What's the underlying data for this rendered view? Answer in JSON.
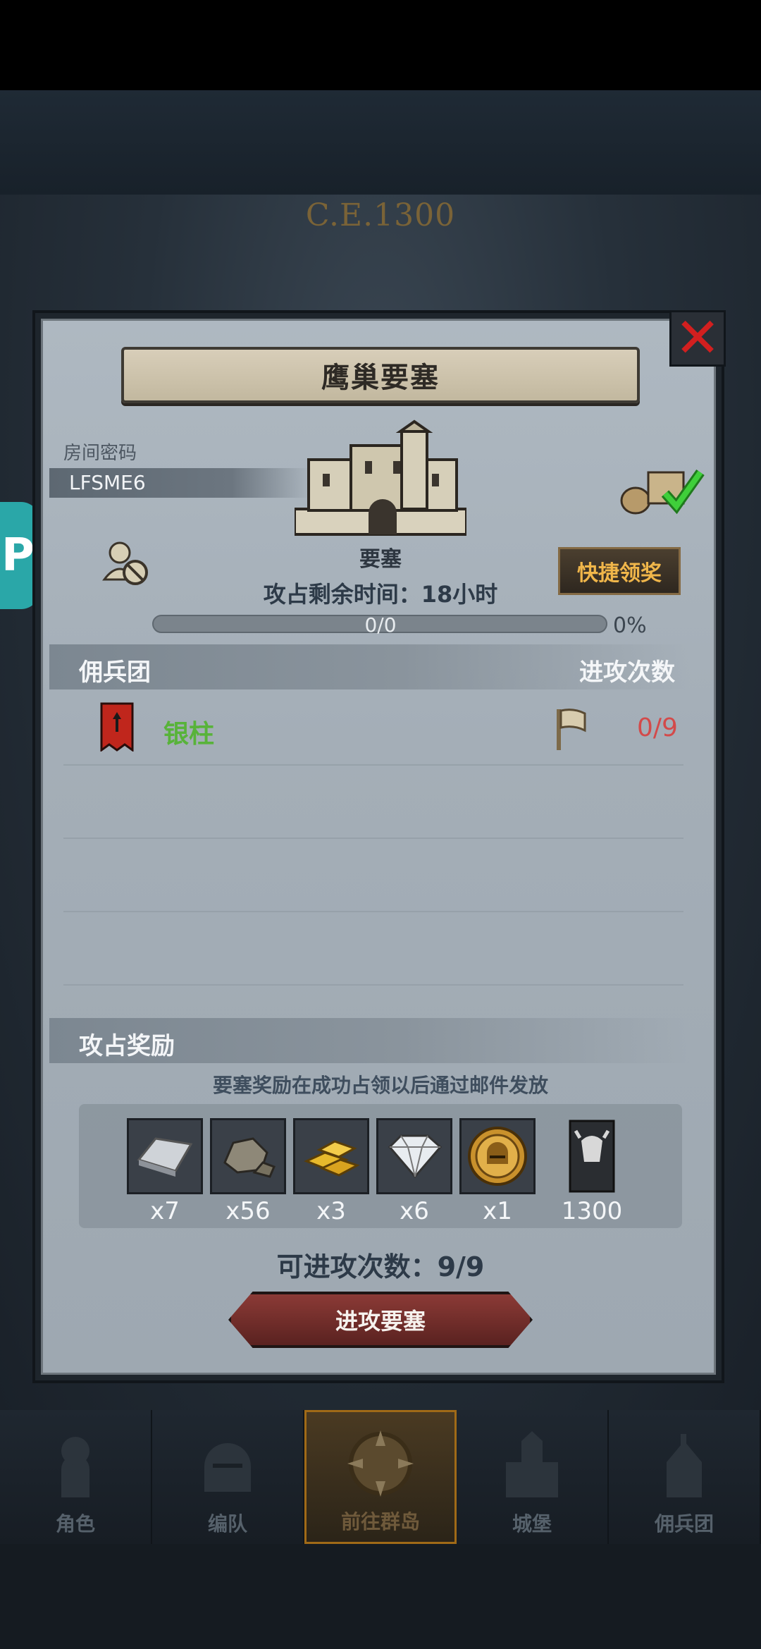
{
  "era": "C.E.1300",
  "side_badge": "P",
  "dialog": {
    "title": "鹰巢要塞",
    "close_icon": "close-icon",
    "room": {
      "label": "房间密码",
      "code": "LFSME6"
    },
    "fortress_label": "要塞",
    "quick_claim_label": "快捷领奖",
    "remaining_time": "攻占剩余时间：18小时",
    "progress": {
      "text": "0/0",
      "percent_text": "0%",
      "fraction": 0
    },
    "legion_section": {
      "title": "佣兵团",
      "right_title": "进攻次数"
    },
    "legions": [
      {
        "name": "银柱",
        "attacks": "0/9",
        "name_color": "#58b33a"
      }
    ],
    "reward_section": {
      "title": "攻占奖励",
      "hint": "要塞奖励在成功占领以后通过邮件发放",
      "items": [
        {
          "icon": "silver-ingot-icon",
          "qty": "x7"
        },
        {
          "icon": "stone-ore-icon",
          "qty": "x56"
        },
        {
          "icon": "gold-bars-icon",
          "qty": "x3"
        },
        {
          "icon": "diamond-icon",
          "qty": "x6"
        },
        {
          "icon": "knight-helmet-coin-icon",
          "qty": "x1"
        },
        {
          "icon": "banner-crest-icon",
          "qty": "1300"
        }
      ]
    },
    "attempts": "可进攻次数：9/9",
    "attack_button": "进攻要塞"
  },
  "nav": {
    "items": [
      {
        "label": "角色",
        "icon": "knight-icon",
        "active": false
      },
      {
        "label": "编队",
        "icon": "helmet-icon",
        "active": false
      },
      {
        "label": "前往群岛",
        "icon": "compass-icon",
        "active": true
      },
      {
        "label": "城堡",
        "icon": "castle-icon",
        "active": false
      },
      {
        "label": "佣兵团",
        "icon": "mercenary-icon",
        "active": false
      }
    ]
  },
  "colors": {
    "accent_gold": "#f0b64a",
    "legion_green": "#58b33a",
    "attack_red": "#d34a4a"
  }
}
